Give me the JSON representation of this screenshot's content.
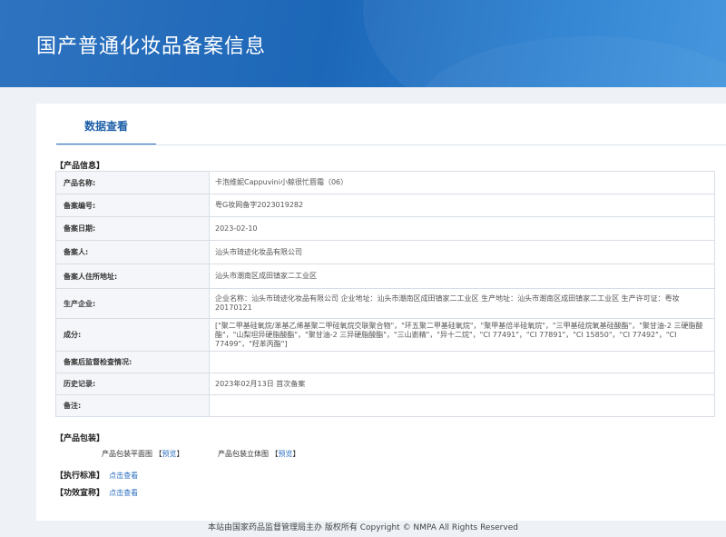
{
  "header": {
    "title": "国产普通化妆品备案信息"
  },
  "tab": {
    "label": "数据查看"
  },
  "product_info": {
    "section_label": "【产品信息】",
    "rows": [
      {
        "label": "产品名称:",
        "value": "卡泡维妮Cappuvini小鲸很忙唇霜（06）"
      },
      {
        "label": "备案编号:",
        "value": "粤G妆网备字2023019282"
      },
      {
        "label": "备案日期:",
        "value": "2023-02-10"
      },
      {
        "label": "备案人:",
        "value": "汕头市琦迹化妆品有限公司"
      },
      {
        "label": "备案人住所地址:",
        "value": "汕头市潮南区成田镇家二工业区"
      },
      {
        "label": "生产企业:",
        "value": "企业名称：汕头市琦迹化妆品有限公司 企业地址：汕头市潮南区成田镇家二工业区 生产地址：汕头市潮南区成田镇家二工业区 生产许可证：粤妆20170121"
      },
      {
        "label": "成分:",
        "value": "[\"聚二甲基硅氧烷/苯基乙烯基聚二甲硅氧烷交联聚合物\"，\"环五聚二甲基硅氧烷\"，\"聚甲基倍半硅氧烷\"，\"三甲基硅烷氧基硅酸酯\"，\"聚甘油-2 三硬脂酸酯\"，\"山梨坦异硬脂酸酯\"，\"聚甘油-2 三异硬脂酸酯\"，\"三山嵛精\"，\"异十二烷\"，\"CI 77491\"，\"CI 77891\"，\"CI 15850\"，\"CI 77492\"，\"CI 77499\"，\"羟苯丙酯\"]"
      },
      {
        "label": "备案后监督检查情况:",
        "value": ""
      },
      {
        "label": "历史记录:",
        "value": "2023年02月13日 首次备案"
      },
      {
        "label": "备注:",
        "value": ""
      }
    ]
  },
  "packaging": {
    "section_label": "【产品包装】",
    "flat_label": "产品包装平面图",
    "flat_link": "预览",
    "solid_label": "产品包装立体图",
    "solid_link": "预览"
  },
  "standard": {
    "label": "【执行标准】",
    "link": "点击查看"
  },
  "efficacy": {
    "label": "【功效宣称】",
    "link": "点击查看"
  },
  "footer": {
    "text": "本站由国家药品监督管理局主办 版权所有 Copyright © NMPA All Rights Reserved"
  }
}
